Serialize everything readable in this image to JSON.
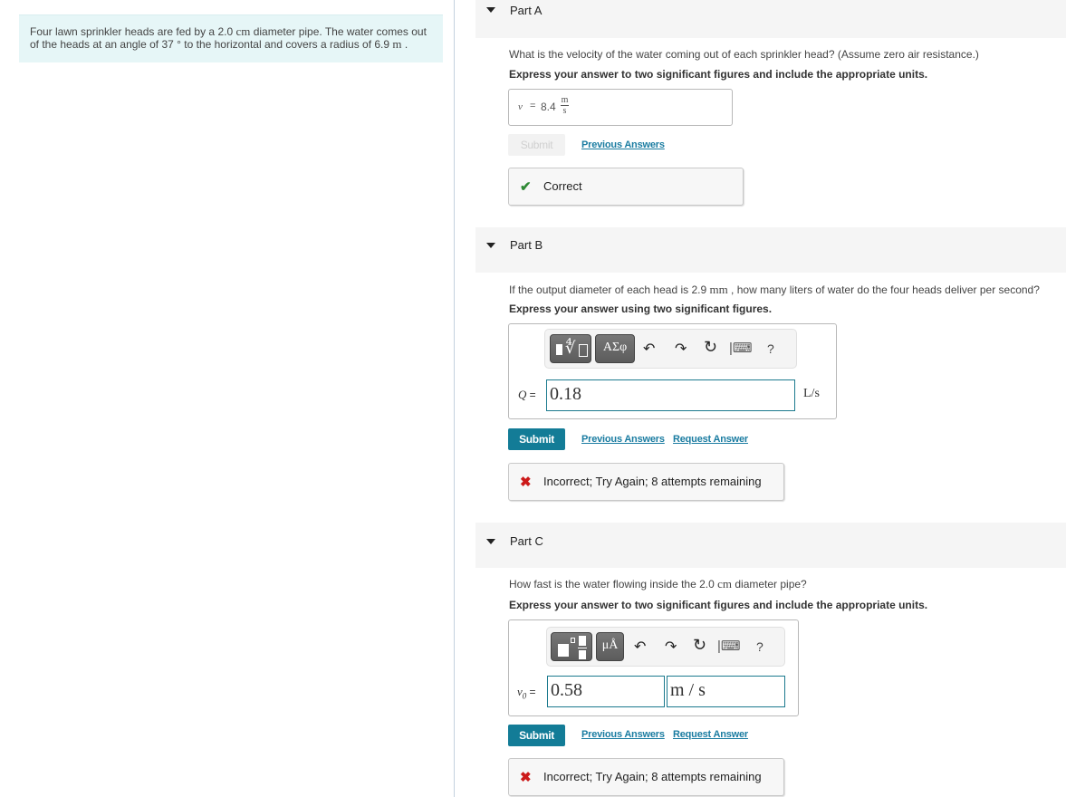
{
  "problem": {
    "text_parts": [
      "Four lawn sprinkler heads are fed by a 2.0 ",
      "cm",
      " diameter pipe. The water comes out of the heads at an angle of 37 ° to the horizontal and covers a radius of 6.9 ",
      "m",
      " ."
    ]
  },
  "parts": [
    {
      "title": "Part A",
      "question_parts": [
        "What is the velocity of the water coming out of each sprinkler head? (Assume zero air resistance.)"
      ],
      "instruction": "Express your answer to two significant figures and include the appropriate units.",
      "answer": {
        "variable": "v",
        "equals": "=",
        "value": "8.4",
        "unit_num": "m",
        "unit_den": "s"
      },
      "submit_label": "Submit",
      "submit_enabled": false,
      "links": [
        "Previous Answers"
      ],
      "feedback": {
        "status": "correct",
        "icon": "check-icon",
        "message": "Correct",
        "color": "#2f8a35"
      }
    },
    {
      "title": "Part B",
      "question_parts": [
        "If the output diameter of each head is 2.9 ",
        "mm",
        " , how many liters of water do the four heads deliver per second?"
      ],
      "instruction": "Express your answer using two significant figures.",
      "toolbar": {
        "templates_label": "√",
        "symbols_label": "ΑΣφ",
        "undo": "↶",
        "redo": "↷",
        "reset": "↻",
        "keyboard": "⌨",
        "help": "?"
      },
      "answer": {
        "variable": "Q",
        "equals": "=",
        "value": "0.18",
        "unit": "L/s"
      },
      "submit_label": "Submit",
      "submit_enabled": true,
      "links": [
        "Previous Answers",
        "Request Answer"
      ],
      "feedback": {
        "status": "incorrect",
        "icon": "x-icon",
        "message": "Incorrect; Try Again; 8 attempts remaining",
        "color": "#cc1a1a"
      }
    },
    {
      "title": "Part C",
      "question_parts": [
        "How fast is the water flowing inside the 2.0 ",
        "cm",
        " diameter pipe?"
      ],
      "instruction": "Express your answer to two significant figures and include the appropriate units.",
      "toolbar": {
        "templates_label": "■□",
        "symbols_label": "μÅ",
        "undo": "↶",
        "redo": "↷",
        "reset": "↻",
        "keyboard": "⌨",
        "help": "?"
      },
      "answer": {
        "variable": "v",
        "subscript": "0",
        "equals": "=",
        "value": "0.58",
        "unit_value": "m / s"
      },
      "submit_label": "Submit",
      "submit_enabled": true,
      "links": [
        "Previous Answers",
        "Request Answer"
      ],
      "feedback": {
        "status": "incorrect",
        "icon": "x-icon",
        "message": "Incorrect; Try Again; 8 attempts remaining",
        "color": "#cc1a1a"
      }
    }
  ],
  "colors": {
    "accent": "#137c97",
    "intro_bg": "#e6f6f7",
    "header_bg": "#f5f5f5",
    "input_border": "#1c7a8e"
  }
}
